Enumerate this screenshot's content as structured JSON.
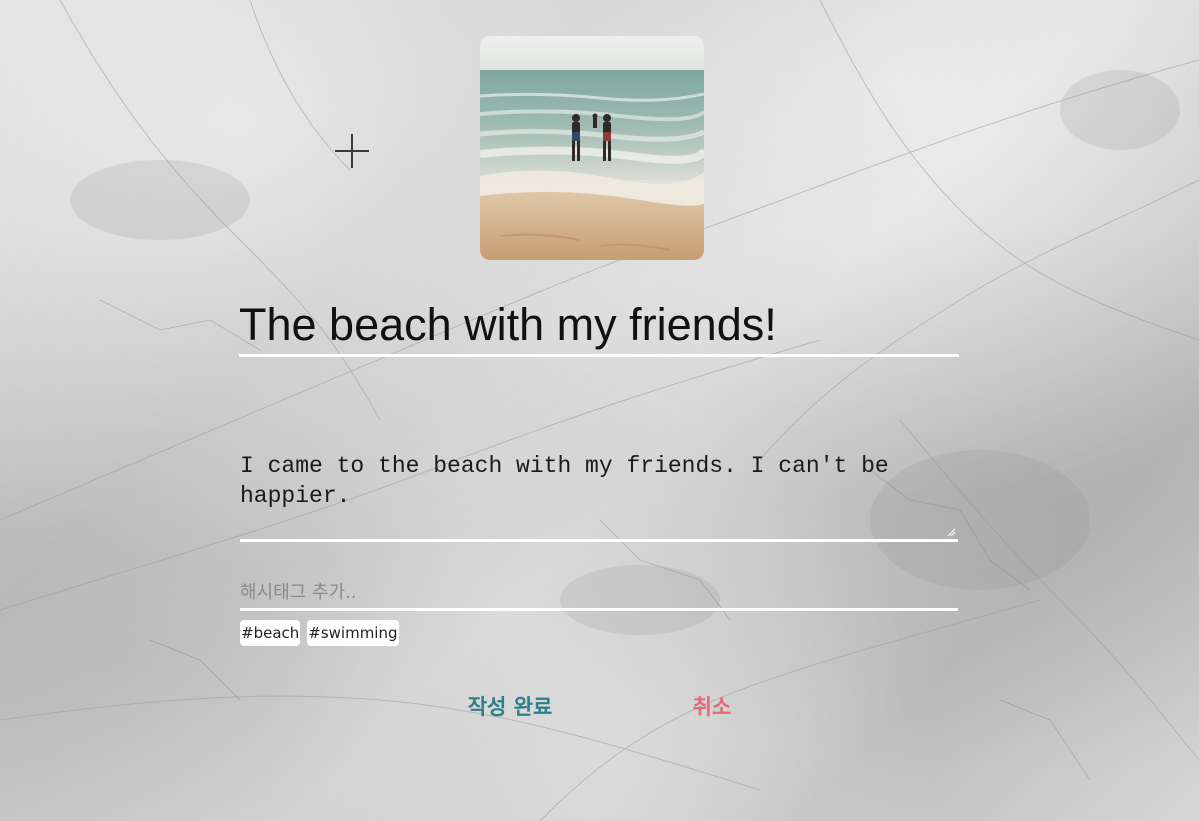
{
  "post_form": {
    "add_photo_icon": "plus-icon",
    "photo_description": "beach photo",
    "title_value": "The beach with my friends!",
    "content_value": "I came to the beach with my friends. I can't be happier.",
    "hashtag_placeholder": "해시태그 추가..",
    "hashtags": [
      "#beach",
      "#swimming"
    ],
    "submit_label": "작성 완료",
    "cancel_label": "취소"
  },
  "colors": {
    "submit": "#2b7f8a",
    "cancel": "#e06a78",
    "underline": "#ffffff"
  }
}
